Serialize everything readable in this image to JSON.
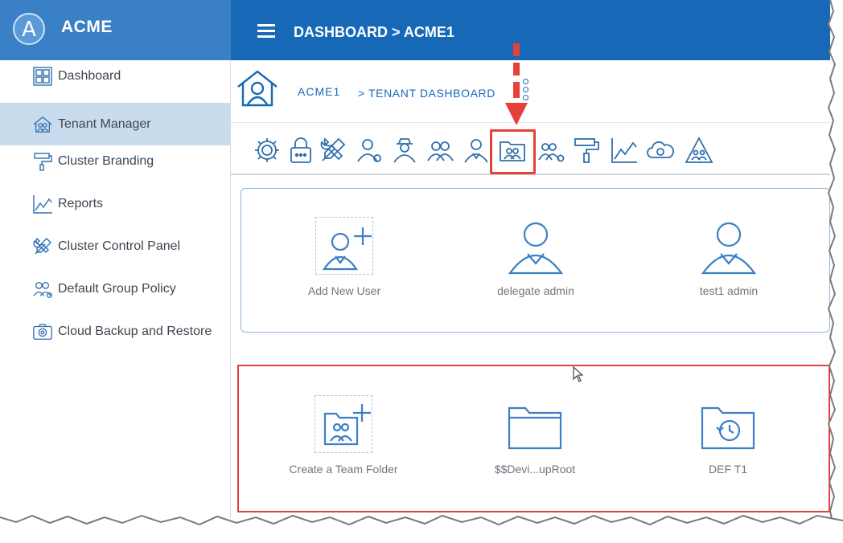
{
  "brand": {
    "logo_letter": "A",
    "name": "ACME"
  },
  "topbar": {
    "title": "DASHBOARD > ACME1"
  },
  "sidebar": {
    "items": [
      {
        "label": "Dashboard",
        "icon": "grid-icon"
      },
      {
        "label": "Tenant Manager",
        "icon": "house-people-icon",
        "active": true
      },
      {
        "label": "Cluster Branding",
        "icon": "paint-roller-icon"
      },
      {
        "label": "Reports",
        "icon": "line-chart-icon"
      },
      {
        "label": "Cluster Control Panel",
        "icon": "tools-icon"
      },
      {
        "label": "Default Group Policy",
        "icon": "group-gear-icon"
      },
      {
        "label": "Cloud Backup and Restore",
        "icon": "camera-icon"
      }
    ]
  },
  "breadcrumb": {
    "tenant": "ACME1",
    "page": "> TENANT DASHBOARD"
  },
  "toolbar": {
    "icons": [
      "gear-icon",
      "lock-icon",
      "tools-icon",
      "user-gear-icon",
      "user-hat-icon",
      "users-icon",
      "user-tie-icon",
      "team-folder-icon",
      "users-gear-icon",
      "paint-roller-icon",
      "line-chart-icon",
      "cloud-icon",
      "warning-group-icon"
    ],
    "highlighted": "team-folder-icon"
  },
  "users_panel": {
    "cards": [
      {
        "label": "Add New User"
      },
      {
        "label": "delegate admin"
      },
      {
        "label": "test1 admin"
      }
    ]
  },
  "folders_panel": {
    "cards": [
      {
        "label": "Create a Team Folder"
      },
      {
        "label": "$$Devi...upRoot"
      },
      {
        "label": "DEF T1"
      }
    ]
  },
  "colors": {
    "brand": "#3a80c6",
    "topbar": "#1769b8",
    "active_nav": "#c9dcee",
    "icon": "#2f6fae",
    "highlight": "#e5403a"
  }
}
